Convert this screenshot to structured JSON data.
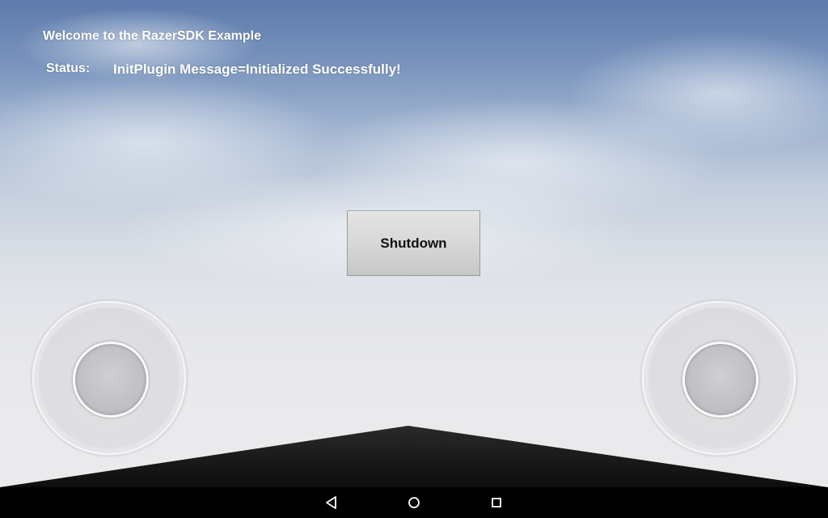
{
  "app": {
    "welcome": "Welcome to the RazerSDK Example",
    "status_label": "Status:",
    "status_message": "InitPlugin Message=Initialized Successfully!"
  },
  "controls": {
    "shutdown_label": "Shutdown"
  },
  "joysticks": {
    "left": {
      "icon": "virtual-joystick-icon"
    },
    "right": {
      "icon": "virtual-joystick-icon"
    }
  },
  "nav_bar": {
    "items": [
      {
        "id": "back",
        "icon": "back-triangle-icon"
      },
      {
        "id": "home",
        "icon": "home-circle-icon"
      },
      {
        "id": "recents",
        "icon": "recents-square-icon"
      }
    ],
    "color": "#000000"
  },
  "colors": {
    "sky_top": "#5d7bab",
    "sky_bottom": "#ebebed",
    "text": "#ffffff",
    "button_face": "#d6d6d6",
    "ground": "#141414"
  }
}
